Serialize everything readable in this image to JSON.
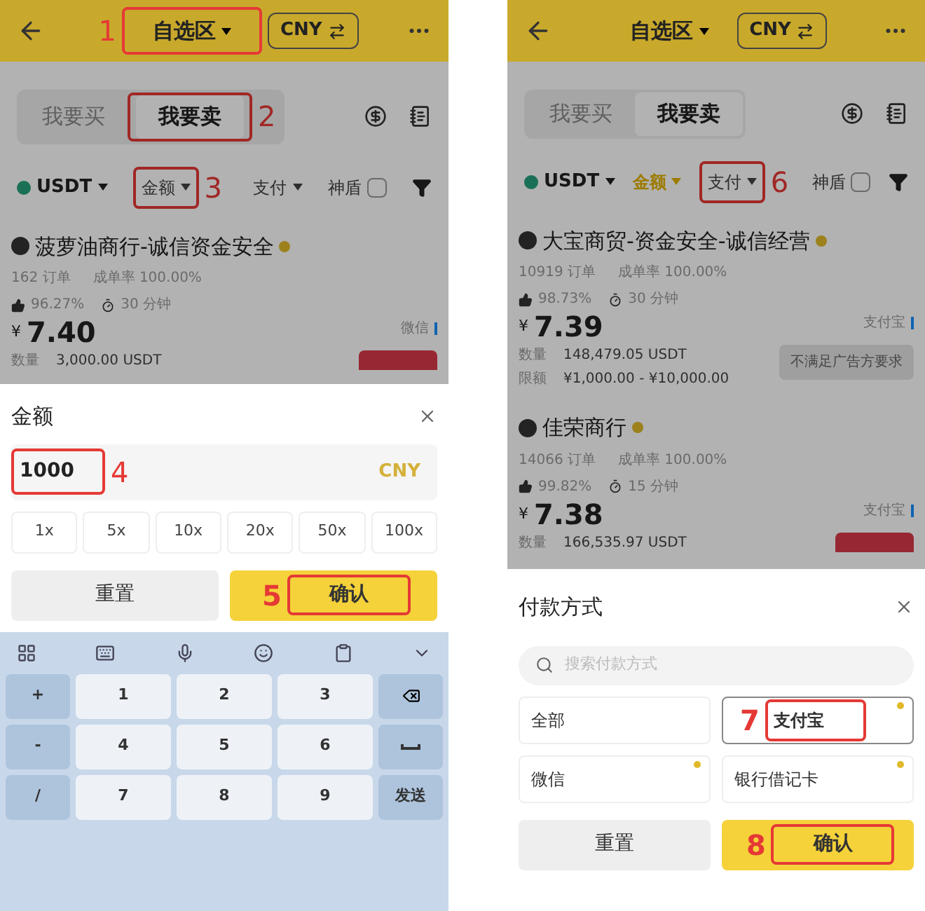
{
  "left": {
    "header": {
      "title": "自选区",
      "title_marker": "1",
      "currency": "CNY"
    },
    "tabs": [
      {
        "label": "我要买",
        "selected": false
      },
      {
        "label": "我要卖",
        "selected": true,
        "marker": "2"
      }
    ],
    "filters": [
      {
        "label": "USDT",
        "kind": "coin"
      },
      {
        "label": "金额",
        "kind": "dropdown",
        "active": false,
        "marker": "3"
      },
      {
        "label": "支付",
        "kind": "dropdown",
        "active": false
      },
      {
        "label": "神盾",
        "kind": "check",
        "checked": false
      }
    ],
    "merchants": [
      {
        "name": "菠萝油商行-诚信资金安全",
        "orders": "162 订单",
        "completion": "成单率 100.00%",
        "rating": "96.27%",
        "time": "30 分钟",
        "currency_sign": "¥",
        "price": "7.40",
        "payment": "微信",
        "details": [
          {
            "label": "数量",
            "value": "3,000.00 USDT"
          }
        ],
        "action": {
          "kind": "sell"
        }
      }
    ],
    "amount_sheet": {
      "title": "金额",
      "value": "1000",
      "value_marker": "4",
      "unit": "CNY",
      "multipliers": [
        "1x",
        "5x",
        "10x",
        "20x",
        "50x",
        "100x"
      ],
      "reset": "重置",
      "confirm": "确认",
      "confirm_marker": "5"
    },
    "keyboard": {
      "rows": [
        [
          "+",
          "1",
          "2",
          "3"
        ],
        [
          "-",
          "4",
          "5",
          "6"
        ],
        [
          "/",
          "7",
          "8",
          "9",
          "发送"
        ]
      ]
    }
  },
  "right": {
    "header": {
      "title": "自选区",
      "currency": "CNY"
    },
    "tabs": [
      {
        "label": "我要买",
        "selected": false
      },
      {
        "label": "我要卖",
        "selected": true
      }
    ],
    "filters": [
      {
        "label": "USDT",
        "kind": "coin"
      },
      {
        "label": "金额",
        "kind": "dropdown",
        "active": true
      },
      {
        "label": "支付",
        "kind": "dropdown",
        "active": false,
        "marker": "6"
      },
      {
        "label": "神盾",
        "kind": "check",
        "checked": false
      }
    ],
    "merchants": [
      {
        "name": "大宝商贸-资金安全-诚信经营",
        "orders": "10919 订单",
        "completion": "成单率 100.00%",
        "rating": "98.73%",
        "time": "30 分钟",
        "currency_sign": "¥",
        "price": "7.39",
        "payment": "支付宝",
        "details": [
          {
            "label": "数量",
            "value": "148,479.05 USDT"
          },
          {
            "label": "限额",
            "value": "¥1,000.00 - ¥10,000.00"
          }
        ],
        "action": {
          "kind": "disabled",
          "label": "不满足广告方要求"
        }
      },
      {
        "name": "佳荣商行",
        "orders": "14066 订单",
        "completion": "成单率 100.00%",
        "rating": "99.82%",
        "time": "15 分钟",
        "currency_sign": "¥",
        "price": "7.38",
        "payment": "支付宝",
        "details": [
          {
            "label": "数量",
            "value": "166,535.97 USDT"
          }
        ],
        "action": {
          "kind": "sell"
        }
      }
    ],
    "payment_sheet": {
      "title": "付款方式",
      "search_placeholder": "搜索付款方式",
      "options": [
        {
          "label": "全部",
          "selected": false,
          "flagged": false
        },
        {
          "label": "支付宝",
          "selected": true,
          "flagged": true,
          "marker": "7"
        },
        {
          "label": "微信",
          "selected": false,
          "flagged": true
        },
        {
          "label": "银行借记卡",
          "selected": false,
          "flagged": true
        }
      ],
      "reset": "重置",
      "confirm": "确认",
      "confirm_marker": "8"
    }
  }
}
